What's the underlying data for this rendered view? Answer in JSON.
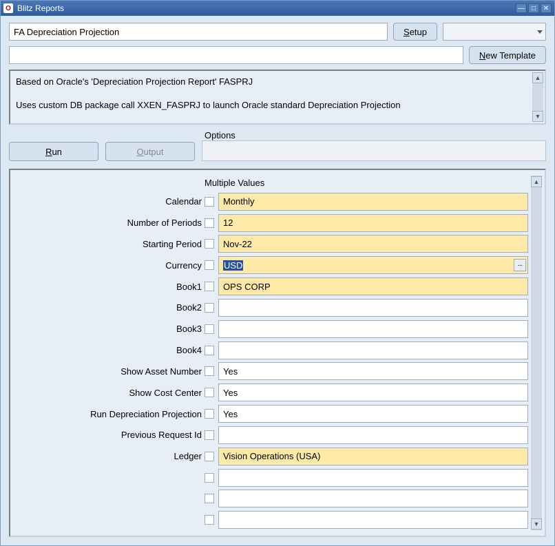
{
  "window": {
    "title": "Blitz Reports"
  },
  "top": {
    "report_name": "FA Depreciation Projection",
    "setup_prefix": "S",
    "setup_rest": "etup",
    "template_value": "",
    "newtpl_prefix": "N",
    "newtpl_rest": "ew Template"
  },
  "desc": {
    "line1": "Based on Oracle's 'Depreciation Projection Report' FASPRJ",
    "line2": "Uses custom DB package call XXEN_FASPRJ to launch Oracle standard Depreciation Projection"
  },
  "actions": {
    "run_prefix": "R",
    "run_rest": "un",
    "output_prefix": "O",
    "output_rest": "utput",
    "options_label": "Options"
  },
  "params": {
    "hdr_multiple": "Multiple Values",
    "labels": {
      "calendar": "Calendar",
      "num_periods": "Number of Periods",
      "start_period": "Starting Period",
      "currency": "Currency",
      "book1": "Book1",
      "book2": "Book2",
      "book3": "Book3",
      "book4": "Book4",
      "show_asset": "Show Asset Number",
      "show_cc": "Show Cost Center",
      "run_dep": "Run Depreciation Projection",
      "prev_req": "Previous Request Id",
      "ledger": "Ledger"
    },
    "values": {
      "calendar": "Monthly",
      "num_periods": "12",
      "start_period": "Nov-22",
      "currency": "USD",
      "book1": "OPS CORP",
      "book2": "",
      "book3": "",
      "book4": "",
      "show_asset": "Yes",
      "show_cc": "Yes",
      "run_dep": "Yes",
      "prev_req": "",
      "ledger": "Vision Operations (USA)"
    }
  }
}
